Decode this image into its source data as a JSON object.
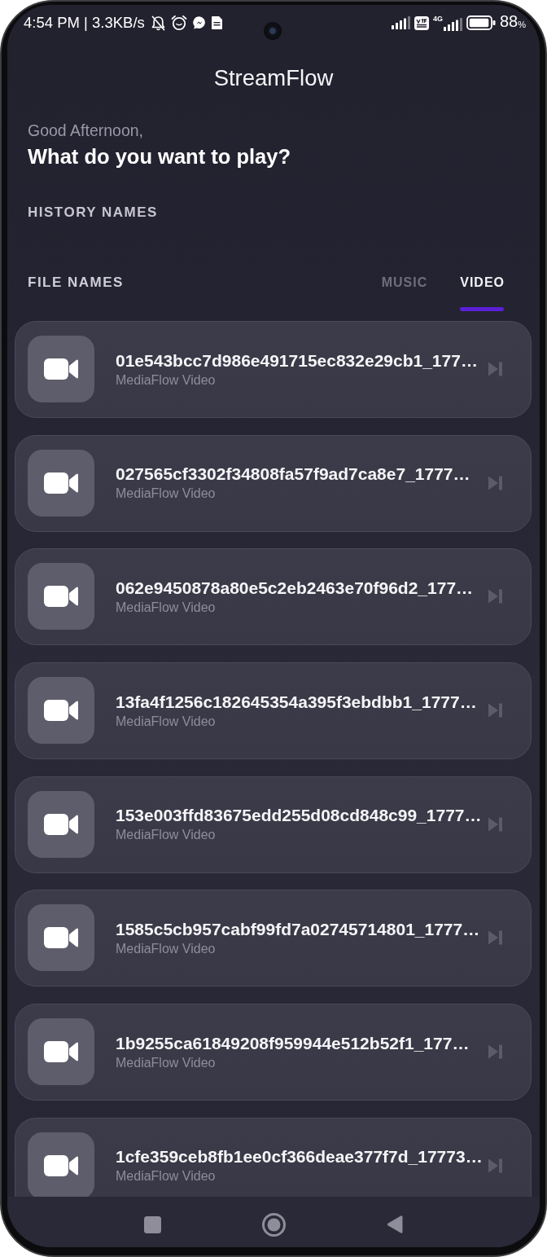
{
  "status_bar": {
    "time_speed": "4:54 PM | 3.3KB/s",
    "network_type": "4G",
    "battery": "88$_{%}$"
  },
  "app_bar": {
    "title": "StreamFlow"
  },
  "greeting": {
    "salutation": "Good Afternoon,",
    "prompt": "What do you want to play?"
  },
  "history": {
    "heading": "HISTORY NAMES"
  },
  "files": {
    "heading": "FILE NAMES",
    "tabs": [
      {
        "label": "MUSIC",
        "selected": false
      },
      {
        "label": "VIDEO",
        "selected": true
      }
    ],
    "items": [
      {
        "title": "01e543bcc7d986e491715ec832e29cb1_177…",
        "subtitle": "MediaFlow Video"
      },
      {
        "title": "027565cf3302f34808fa57f9ad7ca8e7_1777…",
        "subtitle": "MediaFlow Video"
      },
      {
        "title": "062e9450878a80e5c2eb2463e70f96d2_177…",
        "subtitle": "MediaFlow Video"
      },
      {
        "title": "13fa4f1256c182645354a395f3ebdbb1_1777…",
        "subtitle": "MediaFlow Video"
      },
      {
        "title": "153e003ffd83675edd255d08cd848c99_1777…",
        "subtitle": "MediaFlow Video"
      },
      {
        "title": "1585c5cb957cabf99fd7a02745714801_1777…",
        "subtitle": "MediaFlow Video"
      },
      {
        "title": "1b9255ca61849208f959944e512b52f1_177…",
        "subtitle": "MediaFlow Video"
      },
      {
        "title": "1cfe359ceb8fb1ee0cf366deae377f7d_17773…",
        "subtitle": "MediaFlow Video"
      }
    ]
  }
}
